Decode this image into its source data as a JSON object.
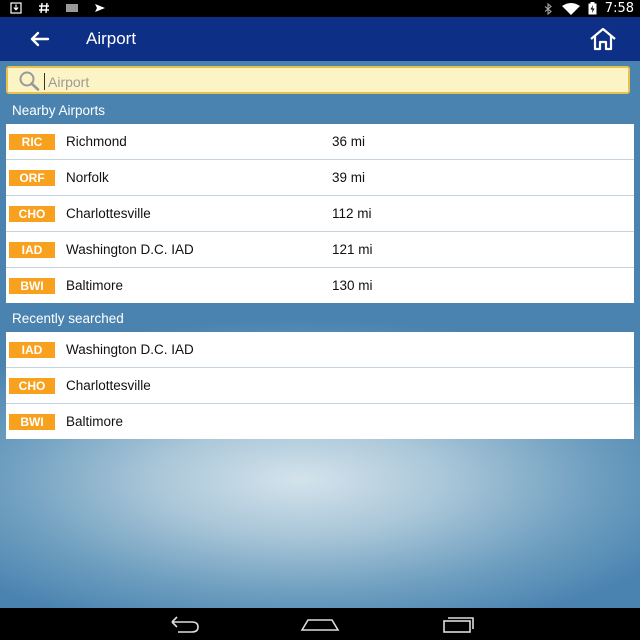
{
  "status_bar": {
    "time": "7:58",
    "left_icons": [
      "download-icon",
      "hash-icon",
      "barcode-icon",
      "send-icon"
    ],
    "right_icons": [
      "bluetooth-icon",
      "wifi-icon",
      "battery-icon"
    ]
  },
  "app_bar": {
    "title": "Airport",
    "back_icon": "arrow-left-icon",
    "home_icon": "home-icon"
  },
  "search": {
    "placeholder": "Airport",
    "value": ""
  },
  "nearby": {
    "title": "Nearby Airports",
    "items": [
      {
        "code": "RIC",
        "city": "Richmond",
        "distance": "36 mi"
      },
      {
        "code": "ORF",
        "city": "Norfolk",
        "distance": "39 mi"
      },
      {
        "code": "CHO",
        "city": "Charlottesville",
        "distance": "112 mi"
      },
      {
        "code": "IAD",
        "city": "Washington D.C. IAD",
        "distance": "121 mi"
      },
      {
        "code": "BWI",
        "city": "Baltimore",
        "distance": "130 mi"
      }
    ]
  },
  "recent": {
    "title": "Recently searched",
    "items": [
      {
        "code": "IAD",
        "city": "Washington D.C. IAD"
      },
      {
        "code": "CHO",
        "city": "Charlottesville"
      },
      {
        "code": "BWI",
        "city": "Baltimore"
      }
    ]
  },
  "colors": {
    "app_bar": "#0d2f86",
    "badge": "#f7a11e",
    "search_bg": "#fdf4c6",
    "search_border": "#e8c24a"
  },
  "nav_bar": {
    "icons": [
      "back-nav-icon",
      "home-nav-icon",
      "recents-nav-icon"
    ]
  }
}
